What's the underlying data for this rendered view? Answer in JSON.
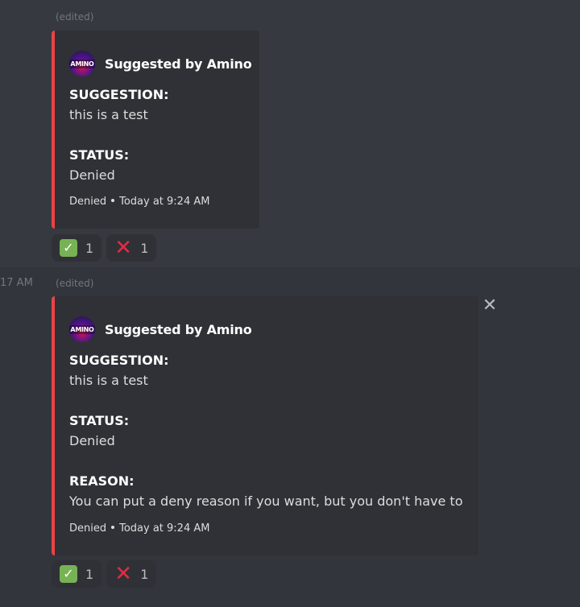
{
  "messages": [
    {
      "timestamp": "",
      "edited_label": "(edited)",
      "embed": {
        "accent_color": "#ed4245",
        "avatar_text": "AMINO",
        "author": "Suggested by Amino",
        "fields": [
          {
            "name": "SUGGESTION:",
            "value": "this is a test"
          },
          {
            "name": "STATUS:",
            "value": "Denied"
          }
        ],
        "footer_text": "Denied",
        "footer_time": "Today at 9:24 AM"
      },
      "reactions": [
        {
          "emoji": "check-mark-emoji",
          "glyph": "✓",
          "count": "1"
        },
        {
          "emoji": "cross-mark-emoji",
          "glyph": "✕",
          "count": "1"
        }
      ]
    },
    {
      "timestamp": "17 AM",
      "edited_label": "(edited)",
      "close_glyph": "✕",
      "embed": {
        "accent_color": "#ed4245",
        "avatar_text": "AMINO",
        "author": "Suggested by Amino",
        "fields": [
          {
            "name": "SUGGESTION:",
            "value": "this is a test"
          },
          {
            "name": "STATUS:",
            "value": "Denied"
          },
          {
            "name": "REASON:",
            "value": "You can put a deny reason if you want, but you don't have to"
          }
        ],
        "footer_text": "Denied",
        "footer_time": "Today at 9:24 AM"
      },
      "reactions": [
        {
          "emoji": "check-mark-emoji",
          "glyph": "✓",
          "count": "1"
        },
        {
          "emoji": "cross-mark-emoji",
          "glyph": "✕",
          "count": "1"
        }
      ]
    }
  ]
}
